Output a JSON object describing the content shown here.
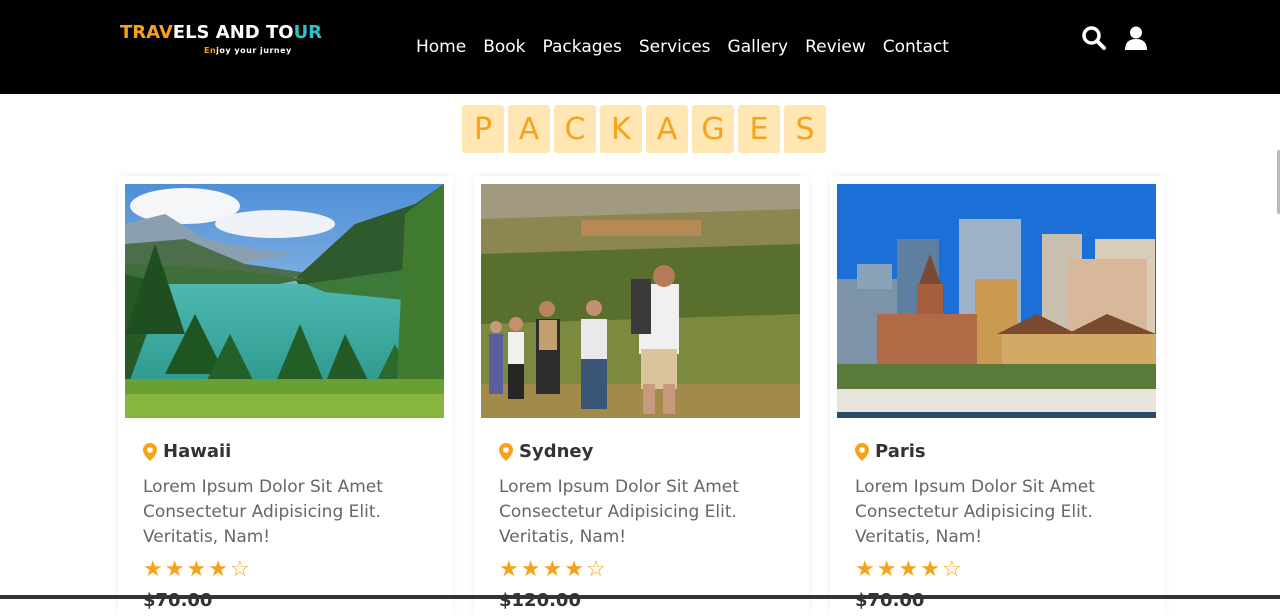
{
  "brand": {
    "title_parts": [
      {
        "text": "TRAV",
        "color": "#f7a21b"
      },
      {
        "text": "ELS AND TO",
        "color": "#ffffff"
      },
      {
        "text": "UR",
        "color": "#2fc1c9"
      }
    ],
    "tagline_accent": "En",
    "tagline_accent_color": "#f7a21b",
    "tagline_rest": "joy your jurney"
  },
  "nav": {
    "links": [
      "Home",
      "Book",
      "Packages",
      "Services",
      "Gallery",
      "Review",
      "Contact"
    ],
    "icons": [
      "search-icon",
      "user-icon"
    ]
  },
  "section": {
    "heading_letters": [
      "P",
      "A",
      "C",
      "K",
      "A",
      "G",
      "E",
      "S"
    ]
  },
  "packages": [
    {
      "image": "lake-mountain-photo",
      "location": "Hawaii",
      "description": "Lorem Ipsum Dolor Sit Amet Consectetur Adipisicing Elit. Veritatis, Nam!",
      "rating": 4,
      "max_rating": 5,
      "price": "$70.00"
    },
    {
      "image": "hikers-photo",
      "location": "Sydney",
      "description": "Lorem Ipsum Dolor Sit Amet Consectetur Adipisicing Elit. Veritatis, Nam!",
      "rating": 4,
      "max_rating": 5,
      "price": "$120.00"
    },
    {
      "image": "city-skyline-photo",
      "location": "Paris",
      "description": "Lorem Ipsum Dolor Sit Amet Consectetur Adipisicing Elit. Veritatis, Nam!",
      "rating": 4,
      "max_rating": 5,
      "price": "$70.00"
    }
  ],
  "colors": {
    "accent": "#f7a21b",
    "accent_light": "#ffe6b3",
    "navbar_bg": "#000000",
    "text_dark": "#333333",
    "text_muted": "#666666"
  }
}
